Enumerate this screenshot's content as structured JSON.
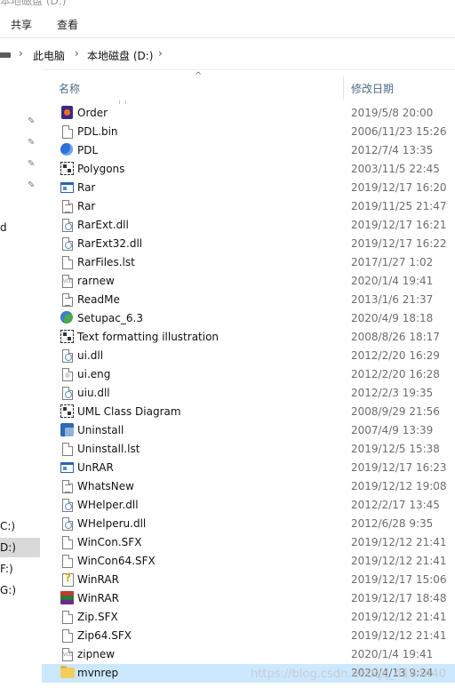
{
  "window": {
    "title_fragment": "本地磁盘 (D:)"
  },
  "ribbon": {
    "tabs": [
      "共享",
      "查看"
    ]
  },
  "address": {
    "crumbs": [
      "此电脑",
      "本地磁盘 (D:)"
    ]
  },
  "nav": {
    "fragments": [
      "d",
      "C:)",
      "D:)",
      "F:)",
      "G:)"
    ]
  },
  "columns": {
    "name": "名称",
    "date": "修改日期"
  },
  "files": [
    {
      "name": "Order",
      "date": "2019/5/8 20:00",
      "icon": "app-order-icon"
    },
    {
      "name": "PDL.bin",
      "date": "2006/11/23 15:26",
      "icon": "generic-file-icon"
    },
    {
      "name": "PDL",
      "date": "2012/7/4 13:35",
      "icon": "globe-app-icon"
    },
    {
      "name": "Polygons",
      "date": "2003/11/5 22:45",
      "icon": "diagram-file-icon"
    },
    {
      "name": "Rar",
      "date": "2019/12/17 16:20",
      "icon": "exe-window-icon"
    },
    {
      "name": "Rar",
      "date": "2019/11/25 21:47",
      "icon": "text-file-icon"
    },
    {
      "name": "RarExt.dll",
      "date": "2019/12/17 16:21",
      "icon": "dll-file-icon"
    },
    {
      "name": "RarExt32.dll",
      "date": "2019/12/17 16:22",
      "icon": "dll-file-icon"
    },
    {
      "name": "RarFiles.lst",
      "date": "2017/1/27 1:02",
      "icon": "generic-file-icon"
    },
    {
      "name": "rarnew",
      "date": "2020/1/4 19:41",
      "icon": "vcd-file-icon"
    },
    {
      "name": "ReadMe",
      "date": "2013/1/6 21:37",
      "icon": "text-file-icon"
    },
    {
      "name": "Setupac_6.3",
      "date": "2020/4/9 18:18",
      "icon": "setup-app-icon"
    },
    {
      "name": "Text formatting illustration",
      "date": "2008/8/26 18:17",
      "icon": "diagram-file-icon"
    },
    {
      "name": "ui.dll",
      "date": "2012/2/20 16:29",
      "icon": "dll-file-icon"
    },
    {
      "name": "ui.eng",
      "date": "2012/2/20 16:28",
      "icon": "settings-file-icon"
    },
    {
      "name": "uiu.dll",
      "date": "2012/2/3 19:35",
      "icon": "dll-file-icon"
    },
    {
      "name": "UML Class Diagram",
      "date": "2008/9/29 21:56",
      "icon": "diagram-file-icon"
    },
    {
      "name": "Uninstall",
      "date": "2007/4/9 13:39",
      "icon": "uninstall-app-icon"
    },
    {
      "name": "Uninstall.lst",
      "date": "2019/12/5 15:38",
      "icon": "generic-file-icon"
    },
    {
      "name": "UnRAR",
      "date": "2019/12/17 16:23",
      "icon": "exe-window-icon"
    },
    {
      "name": "WhatsNew",
      "date": "2019/12/12 19:08",
      "icon": "text-file-icon"
    },
    {
      "name": "WHelper.dll",
      "date": "2012/2/17 13:45",
      "icon": "dll-file-icon"
    },
    {
      "name": "WHelperu.dll",
      "date": "2012/6/28 9:35",
      "icon": "dll-file-icon"
    },
    {
      "name": "WinCon.SFX",
      "date": "2019/12/12 21:41",
      "icon": "generic-file-icon"
    },
    {
      "name": "WinCon64.SFX",
      "date": "2019/12/12 21:41",
      "icon": "generic-file-icon"
    },
    {
      "name": "WinRAR",
      "date": "2019/12/17 15:06",
      "icon": "help-file-icon"
    },
    {
      "name": "WinRAR",
      "date": "2019/12/17 18:48",
      "icon": "winrar-app-icon"
    },
    {
      "name": "Zip.SFX",
      "date": "2019/12/12 21:41",
      "icon": "generic-file-icon"
    },
    {
      "name": "Zip64.SFX",
      "date": "2019/12/12 21:41",
      "icon": "generic-file-icon"
    },
    {
      "name": "zipnew",
      "date": "2020/1/4 19:41",
      "icon": "vcd-file-icon"
    },
    {
      "name": "mvnrep",
      "date": "2020/4/13 9:24",
      "icon": "folder-icon",
      "selected": true
    }
  ],
  "watermark": "https://blog.csdn.net/qq_4164440",
  "colors": {
    "selection": "#cce8ff",
    "header_text": "#4d6b82",
    "date_text": "#6d6d6d"
  }
}
